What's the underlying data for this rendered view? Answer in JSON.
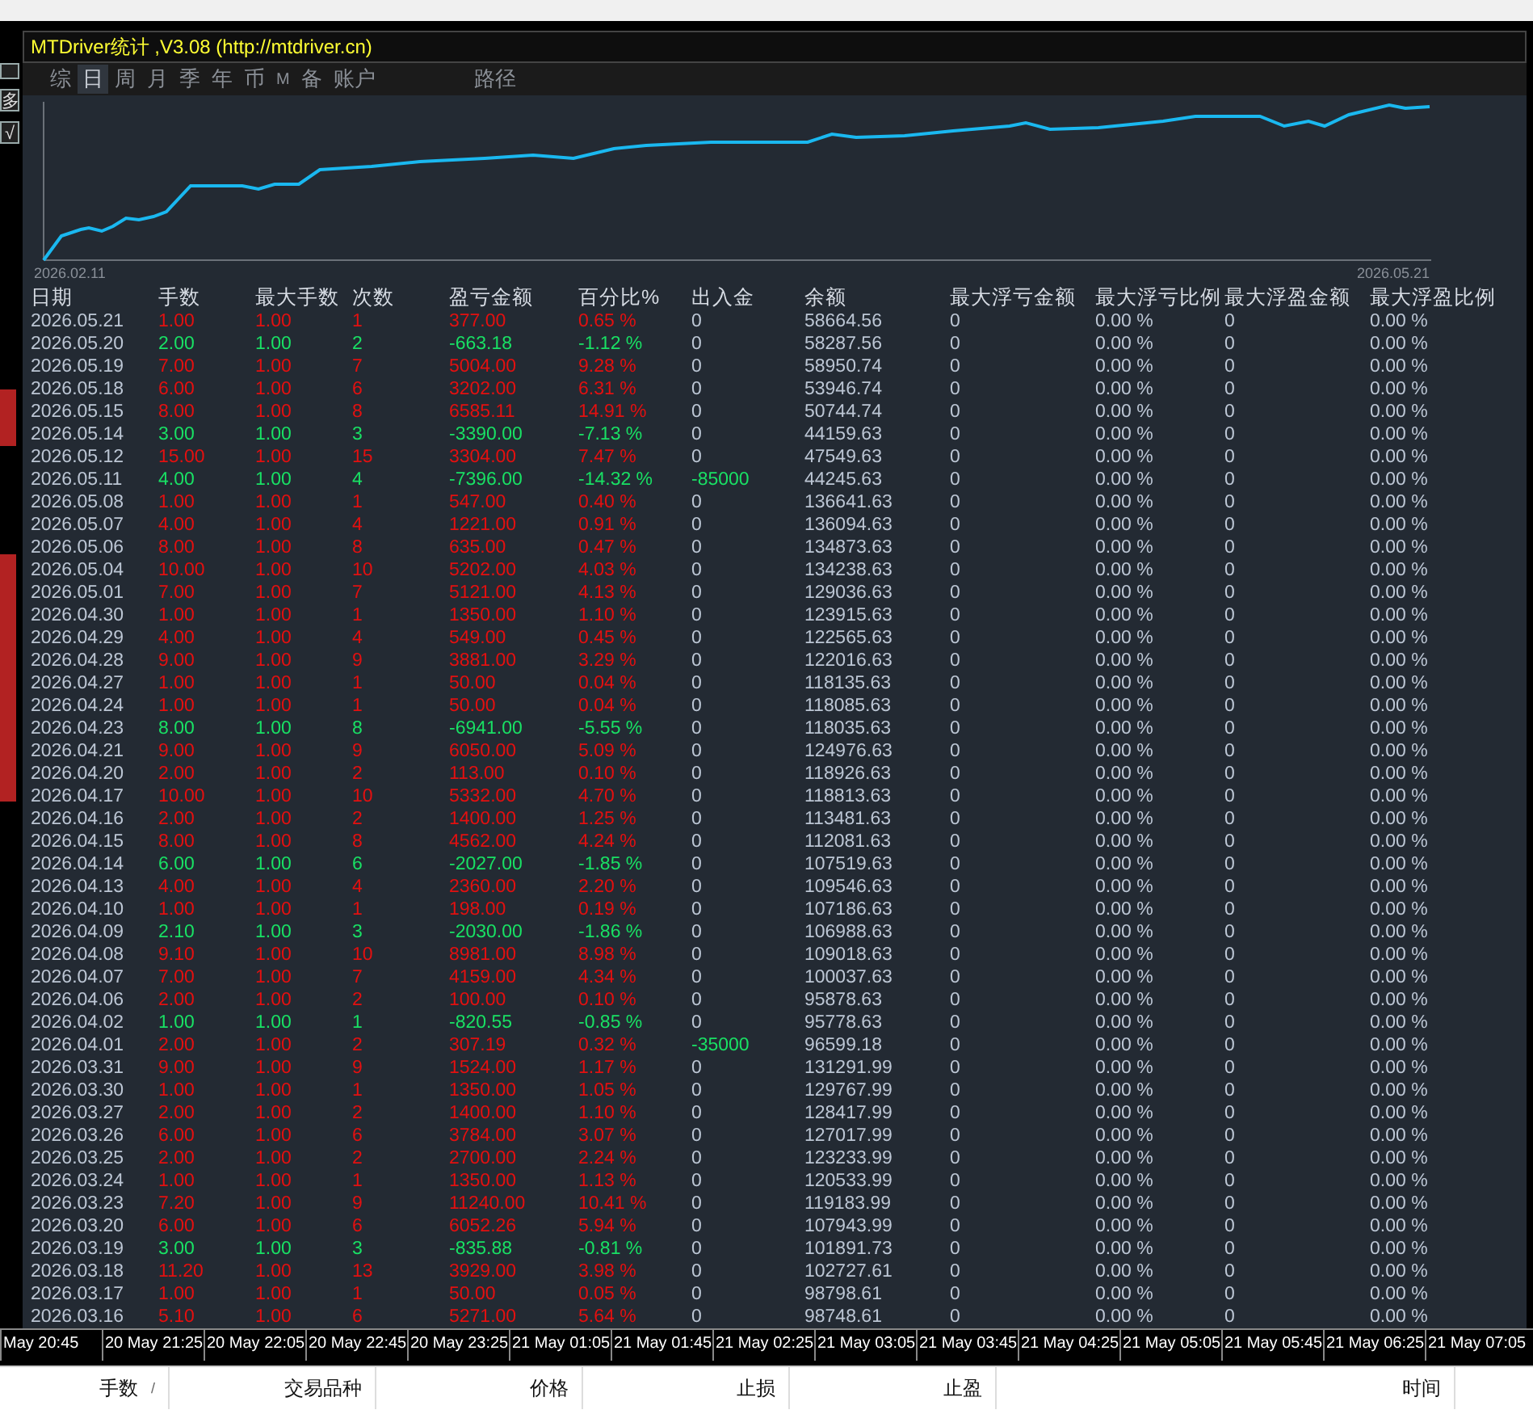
{
  "window": {
    "title": "MTDriver统计 ,V3.08 (http://mtdriver.cn)"
  },
  "side_buttons": [
    "多",
    "√"
  ],
  "tabs": [
    {
      "label": "综",
      "selected": false
    },
    {
      "label": "日",
      "selected": true
    },
    {
      "label": "周",
      "selected": false
    },
    {
      "label": "月",
      "selected": false
    },
    {
      "label": "季",
      "selected": false
    },
    {
      "label": "年",
      "selected": false
    },
    {
      "label": "币",
      "selected": false
    },
    {
      "label": "M",
      "selected": false
    },
    {
      "label": "备",
      "selected": false
    },
    {
      "label": "账户",
      "selected": false
    },
    {
      "label": "路径",
      "selected": false
    }
  ],
  "equity_chart": {
    "start_label": "2026.02.11",
    "end_label": "2026.05.21"
  },
  "table": {
    "columns": [
      "日期",
      "手数",
      "最大手数",
      "次数",
      "盈亏金额",
      "百分比%",
      "出入金",
      "余额",
      "最大浮亏金额",
      "最大浮亏比例",
      "最大浮盈金额",
      "最大浮盈比例"
    ],
    "rows": [
      {
        "kind": "gain",
        "withdrawal": false,
        "cells": [
          "2026.05.21",
          "1.00",
          "1.00",
          "1",
          "377.00",
          "0.65 %",
          "0",
          "58664.56",
          "0",
          "0.00 %",
          "0",
          "0.00 %"
        ]
      },
      {
        "kind": "loss",
        "withdrawal": false,
        "cells": [
          "2026.05.20",
          "2.00",
          "1.00",
          "2",
          "-663.18",
          "-1.12 %",
          "0",
          "58287.56",
          "0",
          "0.00 %",
          "0",
          "0.00 %"
        ]
      },
      {
        "kind": "gain",
        "withdrawal": false,
        "cells": [
          "2026.05.19",
          "7.00",
          "1.00",
          "7",
          "5004.00",
          "9.28 %",
          "0",
          "58950.74",
          "0",
          "0.00 %",
          "0",
          "0.00 %"
        ]
      },
      {
        "kind": "gain",
        "withdrawal": false,
        "cells": [
          "2026.05.18",
          "6.00",
          "1.00",
          "6",
          "3202.00",
          "6.31 %",
          "0",
          "53946.74",
          "0",
          "0.00 %",
          "0",
          "0.00 %"
        ]
      },
      {
        "kind": "gain",
        "withdrawal": false,
        "cells": [
          "2026.05.15",
          "8.00",
          "1.00",
          "8",
          "6585.11",
          "14.91 %",
          "0",
          "50744.74",
          "0",
          "0.00 %",
          "0",
          "0.00 %"
        ]
      },
      {
        "kind": "loss",
        "withdrawal": false,
        "cells": [
          "2026.05.14",
          "3.00",
          "1.00",
          "3",
          "-3390.00",
          "-7.13 %",
          "0",
          "44159.63",
          "0",
          "0.00 %",
          "0",
          "0.00 %"
        ]
      },
      {
        "kind": "gain",
        "withdrawal": false,
        "cells": [
          "2026.05.12",
          "15.00",
          "1.00",
          "15",
          "3304.00",
          "7.47 %",
          "0",
          "47549.63",
          "0",
          "0.00 %",
          "0",
          "0.00 %"
        ]
      },
      {
        "kind": "loss",
        "withdrawal": true,
        "cells": [
          "2026.05.11",
          "4.00",
          "1.00",
          "4",
          "-7396.00",
          "-14.32 %",
          "-85000",
          "44245.63",
          "0",
          "0.00 %",
          "0",
          "0.00 %"
        ]
      },
      {
        "kind": "gain",
        "withdrawal": false,
        "cells": [
          "2026.05.08",
          "1.00",
          "1.00",
          "1",
          "547.00",
          "0.40 %",
          "0",
          "136641.63",
          "0",
          "0.00 %",
          "0",
          "0.00 %"
        ]
      },
      {
        "kind": "gain",
        "withdrawal": false,
        "cells": [
          "2026.05.07",
          "4.00",
          "1.00",
          "4",
          "1221.00",
          "0.91 %",
          "0",
          "136094.63",
          "0",
          "0.00 %",
          "0",
          "0.00 %"
        ]
      },
      {
        "kind": "gain",
        "withdrawal": false,
        "cells": [
          "2026.05.06",
          "8.00",
          "1.00",
          "8",
          "635.00",
          "0.47 %",
          "0",
          "134873.63",
          "0",
          "0.00 %",
          "0",
          "0.00 %"
        ]
      },
      {
        "kind": "gain",
        "withdrawal": false,
        "cells": [
          "2026.05.04",
          "10.00",
          "1.00",
          "10",
          "5202.00",
          "4.03 %",
          "0",
          "134238.63",
          "0",
          "0.00 %",
          "0",
          "0.00 %"
        ]
      },
      {
        "kind": "gain",
        "withdrawal": false,
        "cells": [
          "2026.05.01",
          "7.00",
          "1.00",
          "7",
          "5121.00",
          "4.13 %",
          "0",
          "129036.63",
          "0",
          "0.00 %",
          "0",
          "0.00 %"
        ]
      },
      {
        "kind": "gain",
        "withdrawal": false,
        "cells": [
          "2026.04.30",
          "1.00",
          "1.00",
          "1",
          "1350.00",
          "1.10 %",
          "0",
          "123915.63",
          "0",
          "0.00 %",
          "0",
          "0.00 %"
        ]
      },
      {
        "kind": "gain",
        "withdrawal": false,
        "cells": [
          "2026.04.29",
          "4.00",
          "1.00",
          "4",
          "549.00",
          "0.45 %",
          "0",
          "122565.63",
          "0",
          "0.00 %",
          "0",
          "0.00 %"
        ]
      },
      {
        "kind": "gain",
        "withdrawal": false,
        "cells": [
          "2026.04.28",
          "9.00",
          "1.00",
          "9",
          "3881.00",
          "3.29 %",
          "0",
          "122016.63",
          "0",
          "0.00 %",
          "0",
          "0.00 %"
        ]
      },
      {
        "kind": "gain",
        "withdrawal": false,
        "cells": [
          "2026.04.27",
          "1.00",
          "1.00",
          "1",
          "50.00",
          "0.04 %",
          "0",
          "118135.63",
          "0",
          "0.00 %",
          "0",
          "0.00 %"
        ]
      },
      {
        "kind": "gain",
        "withdrawal": false,
        "cells": [
          "2026.04.24",
          "1.00",
          "1.00",
          "1",
          "50.00",
          "0.04 %",
          "0",
          "118085.63",
          "0",
          "0.00 %",
          "0",
          "0.00 %"
        ]
      },
      {
        "kind": "loss",
        "withdrawal": false,
        "cells": [
          "2026.04.23",
          "8.00",
          "1.00",
          "8",
          "-6941.00",
          "-5.55 %",
          "0",
          "118035.63",
          "0",
          "0.00 %",
          "0",
          "0.00 %"
        ]
      },
      {
        "kind": "gain",
        "withdrawal": false,
        "cells": [
          "2026.04.21",
          "9.00",
          "1.00",
          "9",
          "6050.00",
          "5.09 %",
          "0",
          "124976.63",
          "0",
          "0.00 %",
          "0",
          "0.00 %"
        ]
      },
      {
        "kind": "gain",
        "withdrawal": false,
        "cells": [
          "2026.04.20",
          "2.00",
          "1.00",
          "2",
          "113.00",
          "0.10 %",
          "0",
          "118926.63",
          "0",
          "0.00 %",
          "0",
          "0.00 %"
        ]
      },
      {
        "kind": "gain",
        "withdrawal": false,
        "cells": [
          "2026.04.17",
          "10.00",
          "1.00",
          "10",
          "5332.00",
          "4.70 %",
          "0",
          "118813.63",
          "0",
          "0.00 %",
          "0",
          "0.00 %"
        ]
      },
      {
        "kind": "gain",
        "withdrawal": false,
        "cells": [
          "2026.04.16",
          "2.00",
          "1.00",
          "2",
          "1400.00",
          "1.25 %",
          "0",
          "113481.63",
          "0",
          "0.00 %",
          "0",
          "0.00 %"
        ]
      },
      {
        "kind": "gain",
        "withdrawal": false,
        "cells": [
          "2026.04.15",
          "8.00",
          "1.00",
          "8",
          "4562.00",
          "4.24 %",
          "0",
          "112081.63",
          "0",
          "0.00 %",
          "0",
          "0.00 %"
        ]
      },
      {
        "kind": "loss",
        "withdrawal": false,
        "cells": [
          "2026.04.14",
          "6.00",
          "1.00",
          "6",
          "-2027.00",
          "-1.85 %",
          "0",
          "107519.63",
          "0",
          "0.00 %",
          "0",
          "0.00 %"
        ]
      },
      {
        "kind": "gain",
        "withdrawal": false,
        "cells": [
          "2026.04.13",
          "4.00",
          "1.00",
          "4",
          "2360.00",
          "2.20 %",
          "0",
          "109546.63",
          "0",
          "0.00 %",
          "0",
          "0.00 %"
        ]
      },
      {
        "kind": "gain",
        "withdrawal": false,
        "cells": [
          "2026.04.10",
          "1.00",
          "1.00",
          "1",
          "198.00",
          "0.19 %",
          "0",
          "107186.63",
          "0",
          "0.00 %",
          "0",
          "0.00 %"
        ]
      },
      {
        "kind": "loss",
        "withdrawal": false,
        "cells": [
          "2026.04.09",
          "2.10",
          "1.00",
          "3",
          "-2030.00",
          "-1.86 %",
          "0",
          "106988.63",
          "0",
          "0.00 %",
          "0",
          "0.00 %"
        ]
      },
      {
        "kind": "gain",
        "withdrawal": false,
        "cells": [
          "2026.04.08",
          "9.10",
          "1.00",
          "10",
          "8981.00",
          "8.98 %",
          "0",
          "109018.63",
          "0",
          "0.00 %",
          "0",
          "0.00 %"
        ]
      },
      {
        "kind": "gain",
        "withdrawal": false,
        "cells": [
          "2026.04.07",
          "7.00",
          "1.00",
          "7",
          "4159.00",
          "4.34 %",
          "0",
          "100037.63",
          "0",
          "0.00 %",
          "0",
          "0.00 %"
        ]
      },
      {
        "kind": "gain",
        "withdrawal": false,
        "cells": [
          "2026.04.06",
          "2.00",
          "1.00",
          "2",
          "100.00",
          "0.10 %",
          "0",
          "95878.63",
          "0",
          "0.00 %",
          "0",
          "0.00 %"
        ]
      },
      {
        "kind": "loss",
        "withdrawal": false,
        "cells": [
          "2026.04.02",
          "1.00",
          "1.00",
          "1",
          "-820.55",
          "-0.85 %",
          "0",
          "95778.63",
          "0",
          "0.00 %",
          "0",
          "0.00 %"
        ]
      },
      {
        "kind": "gain",
        "withdrawal": true,
        "cells": [
          "2026.04.01",
          "2.00",
          "1.00",
          "2",
          "307.19",
          "0.32 %",
          "-35000",
          "96599.18",
          "0",
          "0.00 %",
          "0",
          "0.00 %"
        ]
      },
      {
        "kind": "gain",
        "withdrawal": false,
        "cells": [
          "2026.03.31",
          "9.00",
          "1.00",
          "9",
          "1524.00",
          "1.17 %",
          "0",
          "131291.99",
          "0",
          "0.00 %",
          "0",
          "0.00 %"
        ]
      },
      {
        "kind": "gain",
        "withdrawal": false,
        "cells": [
          "2026.03.30",
          "1.00",
          "1.00",
          "1",
          "1350.00",
          "1.05 %",
          "0",
          "129767.99",
          "0",
          "0.00 %",
          "0",
          "0.00 %"
        ]
      },
      {
        "kind": "gain",
        "withdrawal": false,
        "cells": [
          "2026.03.27",
          "2.00",
          "1.00",
          "2",
          "1400.00",
          "1.10 %",
          "0",
          "128417.99",
          "0",
          "0.00 %",
          "0",
          "0.00 %"
        ]
      },
      {
        "kind": "gain",
        "withdrawal": false,
        "cells": [
          "2026.03.26",
          "6.00",
          "1.00",
          "6",
          "3784.00",
          "3.07 %",
          "0",
          "127017.99",
          "0",
          "0.00 %",
          "0",
          "0.00 %"
        ]
      },
      {
        "kind": "gain",
        "withdrawal": false,
        "cells": [
          "2026.03.25",
          "2.00",
          "1.00",
          "2",
          "2700.00",
          "2.24 %",
          "0",
          "123233.99",
          "0",
          "0.00 %",
          "0",
          "0.00 %"
        ]
      },
      {
        "kind": "gain",
        "withdrawal": false,
        "cells": [
          "2026.03.24",
          "1.00",
          "1.00",
          "1",
          "1350.00",
          "1.13 %",
          "0",
          "120533.99",
          "0",
          "0.00 %",
          "0",
          "0.00 %"
        ]
      },
      {
        "kind": "gain",
        "withdrawal": false,
        "cells": [
          "2026.03.23",
          "7.20",
          "1.00",
          "9",
          "11240.00",
          "10.41 %",
          "0",
          "119183.99",
          "0",
          "0.00 %",
          "0",
          "0.00 %"
        ]
      },
      {
        "kind": "gain",
        "withdrawal": false,
        "cells": [
          "2026.03.20",
          "6.00",
          "1.00",
          "6",
          "6052.26",
          "5.94 %",
          "0",
          "107943.99",
          "0",
          "0.00 %",
          "0",
          "0.00 %"
        ]
      },
      {
        "kind": "loss",
        "withdrawal": false,
        "cells": [
          "2026.03.19",
          "3.00",
          "1.00",
          "3",
          "-835.88",
          "-0.81 %",
          "0",
          "101891.73",
          "0",
          "0.00 %",
          "0",
          "0.00 %"
        ]
      },
      {
        "kind": "gain",
        "withdrawal": false,
        "cells": [
          "2026.03.18",
          "11.20",
          "1.00",
          "13",
          "3929.00",
          "3.98 %",
          "0",
          "102727.61",
          "0",
          "0.00 %",
          "0",
          "0.00 %"
        ]
      },
      {
        "kind": "gain",
        "withdrawal": false,
        "cells": [
          "2026.03.17",
          "1.00",
          "1.00",
          "1",
          "50.00",
          "0.05 %",
          "0",
          "98798.61",
          "0",
          "0.00 %",
          "0",
          "0.00 %"
        ]
      },
      {
        "kind": "gain",
        "withdrawal": false,
        "cells": [
          "2026.03.16",
          "5.10",
          "1.00",
          "6",
          "5271.00",
          "5.64 %",
          "0",
          "98748.61",
          "0",
          "0.00 %",
          "0",
          "0.00 %"
        ]
      }
    ]
  },
  "time_axis": [
    "May 20:45",
    "20 May 21:25",
    "20 May 22:05",
    "20 May 22:45",
    "20 May 23:25",
    "21 May 01:05",
    "21 May 01:45",
    "21 May 02:25",
    "21 May 03:05",
    "21 May 03:45",
    "21 May 04:25",
    "21 May 05:05",
    "21 May 05:45",
    "21 May 06:25",
    "21 May 07:05"
  ],
  "order_columns": [
    {
      "label": "手数",
      "sort_mark": "/"
    },
    {
      "label": "交易品种"
    },
    {
      "label": "价格"
    },
    {
      "label": "止损"
    },
    {
      "label": "止盈"
    },
    {
      "label": "时间"
    }
  ]
}
